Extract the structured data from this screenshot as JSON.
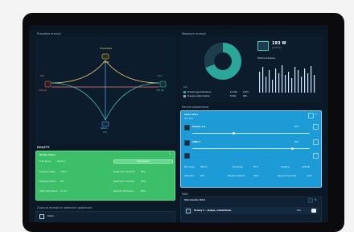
{
  "app": {
    "accent_blue": "#1d9bd6",
    "accent_green": "#3dbf6a",
    "bg": "#0b1826"
  },
  "energy_flow": {
    "title": "Przepływ energii",
    "nodes": {
      "top": {
        "label": "Fotowoltaika",
        "value": "193 W"
      },
      "left": {
        "label": "Sieć",
        "value": "2,84 kW"
      },
      "right": {
        "label": "Dom",
        "value": "3,03 kW"
      },
      "bottom": {
        "label": "Bateria",
        "value": "0 W"
      }
    }
  },
  "energy_mag": {
    "title": "Magazyn energii",
    "power": "193 W",
    "power_sub": "produkcja",
    "history_title": "Historia ładowania",
    "legend_title": "Dziś",
    "legend": [
      {
        "label": "Energia wyprodukowana",
        "value": "12 kWh",
        "pct": "100%"
      },
      {
        "label": "Energia zużyta lokalnie",
        "value": "8 kWh",
        "pct": "66%"
      }
    ]
  },
  "blind": {
    "title": "ROLETY",
    "card_title": "Rolety Salon",
    "rows": [
      {
        "k": "Tryb pracy",
        "v": "Ręczny",
        "k2": "",
        "v2": ""
      },
      {
        "k": "Pozycja rolety",
        "v": "100%",
        "k2": "Nasłonecz. wschód",
        "v2": "86%"
      },
      {
        "k": "Pozycja lameli",
        "v": "45°",
        "k2": "Nasłonecz. zachód",
        "v2": "98%"
      },
      {
        "k": "Czas zamykania",
        "v": "21:44",
        "k2": "Jasność otoczenia",
        "v2": "80%"
      }
    ],
    "button": "Sterowanie"
  },
  "bottom_left": {
    "title": "Zużycie energii w ostatnich godzinach",
    "item": "Pobór"
  },
  "lighting": {
    "title": "Panele oświetlenia",
    "card_title": "Salon DALI",
    "card_sub": "Dim 45%",
    "channels": [
      {
        "name": "Ściany 1-3",
        "pct": "45%",
        "pct2": "45%"
      },
      {
        "name": "CWU 3",
        "pct": "86%",
        "pct2": "86%"
      }
    ],
    "stats": [
      {
        "k": "Moc lampy",
        "v": "285 lm",
        "k2": "Sprawność",
        "v2": "87 %",
        "k3": "Przepływ",
        "v3": "0,00 kW"
      },
      {
        "k": "Obecność",
        "v": "8,8 l",
        "k2": "Napięcie zasilania",
        "v2": "230 V",
        "k3": "Napięcie wyjściowe",
        "v3": "0,6 V"
      }
    ]
  },
  "bottom_right": {
    "title": "DALI",
    "card_title": "Sterowanie DALI",
    "row": "Ściany 1 – lampa, oświetlenie",
    "row_pct": "86%"
  }
}
